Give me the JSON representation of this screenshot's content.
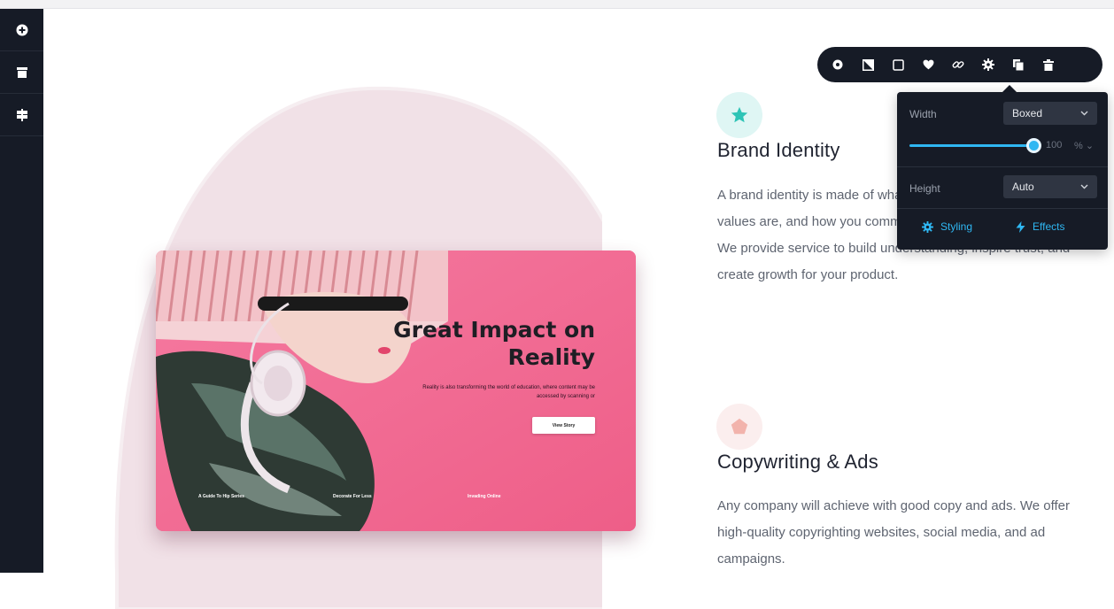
{
  "sidebar": {
    "items": [
      {
        "icon": "add-circle-icon"
      },
      {
        "icon": "archive-icon"
      },
      {
        "icon": "signpost-icon"
      }
    ]
  },
  "hero_card": {
    "title": "Great Impact on\nReality",
    "text": "Reality is also transforming the world of education, where content may be accessed by scanning or",
    "button_label": "View Story",
    "footer_links": [
      "A Guide To Hip Series",
      "Decorate For Less",
      "Invading Online"
    ]
  },
  "features": [
    {
      "icon": "star-icon",
      "title": "Brand Identity",
      "text": "A brand identity is made of what your brand sys, what your values are, and how you communicate about your product. We provide service to build understanding, inspire trust, and create growth for your product."
    },
    {
      "icon": "pentagon-icon",
      "title": "Copywriting & Ads",
      "text": "Any company will achieve with good copy and ads. We offer high-quality copyrighting websites, social media, and ad campaigns."
    }
  ],
  "toolbar": {
    "buttons": [
      {
        "icon": "circle-settings-icon"
      },
      {
        "icon": "half-square-icon"
      },
      {
        "icon": "square-icon"
      },
      {
        "icon": "heart-icon"
      },
      {
        "icon": "link-icon"
      },
      {
        "icon": "gear-icon"
      },
      {
        "icon": "copy-icon"
      },
      {
        "icon": "trash-icon"
      }
    ]
  },
  "panel": {
    "width_label": "Width",
    "width_value": "Boxed",
    "slider_value": "100",
    "slider_unit": "% ⌄",
    "slider_fraction": 1.0,
    "height_label": "Height",
    "height_value": "Auto",
    "styling_label": "Styling",
    "effects_label": "Effects"
  },
  "colors": {
    "sidebar": "#161b26",
    "accent": "#2fb7f2",
    "teal": "#2ec4b6",
    "pink_card": "#f26a92",
    "blob": "#f1e1e7"
  }
}
